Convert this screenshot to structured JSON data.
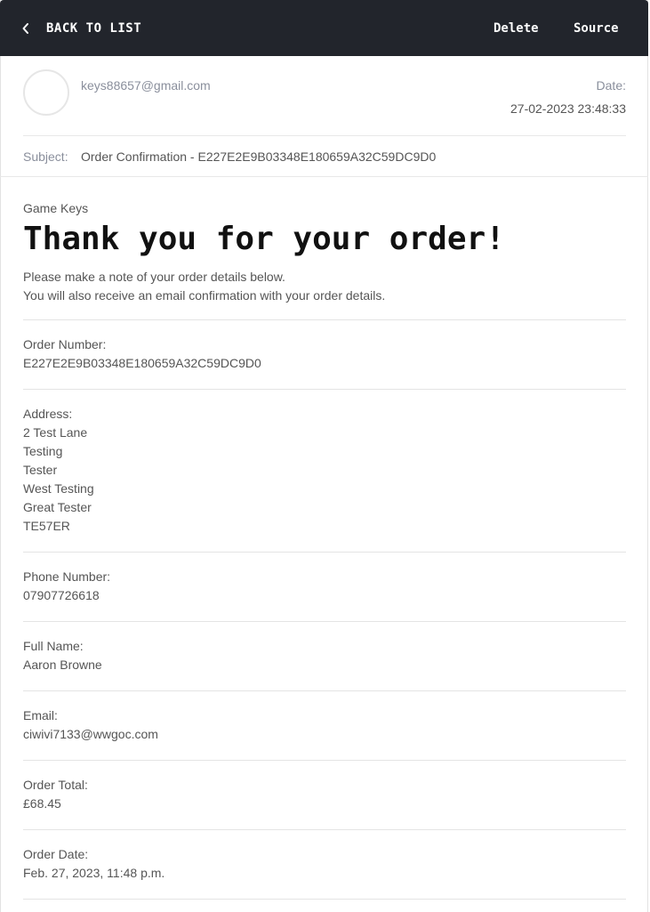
{
  "toolbar": {
    "back_label": "BACK TO LIST",
    "delete_label": "Delete",
    "source_label": "Source"
  },
  "header": {
    "sender": "keys88657@gmail.com",
    "date_label": "Date:",
    "date_value": "27-02-2023 23:48:33",
    "subject_label": "Subject:",
    "subject_value": "Order Confirmation - E227E2E9B03348E180659A32C59DC9D0"
  },
  "body": {
    "brand": "Game Keys",
    "heading": "Thank you for your order!",
    "intro_line1": "Please make a note of your order details below.",
    "intro_line2": "You will also receive an email confirmation with your order details.",
    "order_number_label": "Order Number:",
    "order_number": "E227E2E9B03348E180659A32C59DC9D0",
    "address_label": "Address:",
    "address_lines": [
      "2 Test Lane",
      "Testing",
      "Tester",
      "West Testing",
      "Great Tester",
      "TE57ER"
    ],
    "phone_label": "Phone Number:",
    "phone": "07907726618",
    "full_name_label": "Full Name:",
    "full_name": "Aaron Browne",
    "email_label": "Email:",
    "email": "ciwivi7133@wwgoc.com",
    "order_total_label": "Order Total:",
    "order_total": "£68.45",
    "order_date_label": "Order Date:",
    "order_date": "Feb. 27, 2023, 11:48 p.m."
  },
  "colors": {
    "topbar": "#22252c",
    "muted_text": "#8a8f9c",
    "body_text": "#555555"
  }
}
